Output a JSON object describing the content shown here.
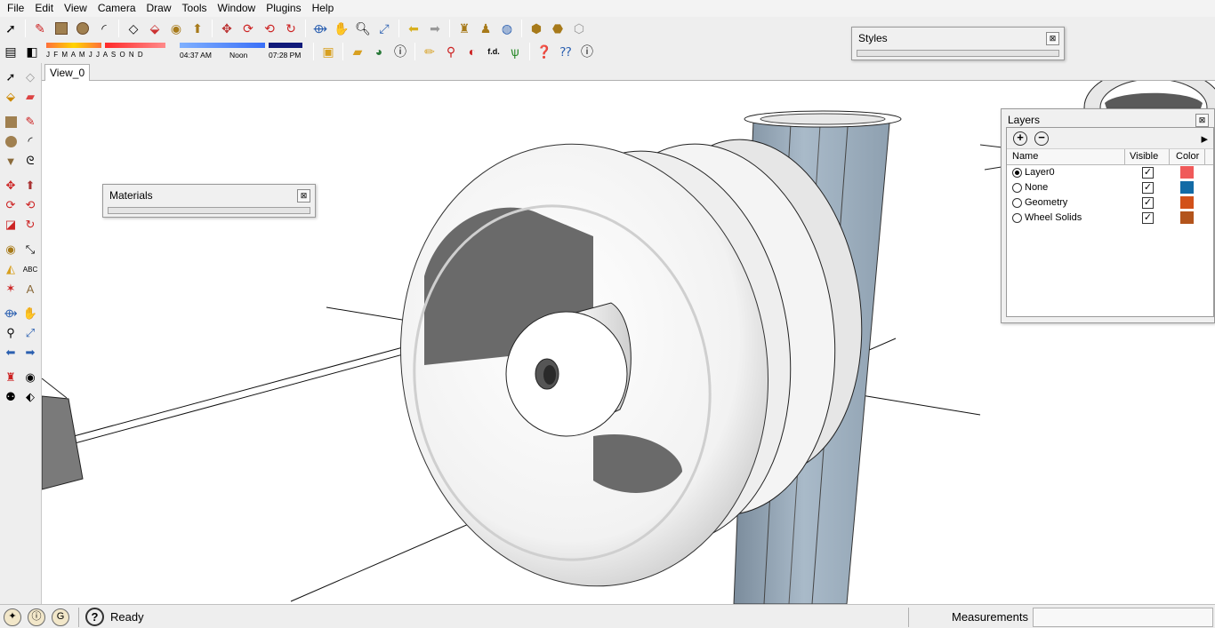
{
  "menu": [
    "File",
    "Edit",
    "View",
    "Camera",
    "Draw",
    "Tools",
    "Window",
    "Plugins",
    "Help"
  ],
  "shadow_months": "J F M A M J J A S O N D",
  "shadow_times": {
    "start": "04:37 AM",
    "mid": "Noon",
    "end": "07:28 PM"
  },
  "scene_tab": "View_0",
  "styles_tray": {
    "title": "Styles",
    "close": "⊠"
  },
  "materials_tray": {
    "title": "Materials",
    "close": "⊠"
  },
  "layers_tray": {
    "title": "Layers",
    "close": "⊠",
    "add": "+",
    "remove": "−",
    "details": "▸",
    "columns": {
      "name": "Name",
      "visible": "Visible",
      "color": "Color"
    },
    "rows": [
      {
        "name": "Layer0",
        "active": true,
        "visible": "✓",
        "color": "#f05a5a"
      },
      {
        "name": "None",
        "active": false,
        "visible": "✓",
        "color": "#136ba6"
      },
      {
        "name": "Geometry",
        "active": false,
        "visible": "✓",
        "color": "#d2511a"
      },
      {
        "name": "Wheel Solids",
        "active": false,
        "visible": "✓",
        "color": "#b3541c"
      }
    ]
  },
  "status": {
    "text": "Ready",
    "help": "?",
    "measurements_label": "Measurements"
  },
  "colors": {
    "pole": "#9fb1c2",
    "wheel_shade": "#6a6a6a",
    "box": "#7a7a7a"
  },
  "icons": {
    "top_row1": [
      "select-icon",
      "pencil-icon",
      "rectangle-icon",
      "circle-icon",
      "arc-icon",
      "eraser-icon",
      "paint-bucket-icon",
      "tape-icon",
      "push-pull-icon",
      "move-icon",
      "rotate-icon",
      "offset-icon",
      "orbit-icon",
      "pan-icon",
      "zoom-icon",
      "zoom-extents-icon",
      "previous-view-icon",
      "next-view-icon",
      "walk-icon",
      "position-camera-icon",
      "look-around-icon",
      "component-icon",
      "group-icon",
      "section-icon"
    ],
    "top_row2": [
      "get-models-icon",
      "share-icon",
      "sandbox-icon",
      "folder-icon",
      "globe-icon",
      "info-icon",
      "pencil2-icon",
      "dropper-icon",
      "outline-icon",
      "fd-icon",
      "grass-icon",
      "help-icon",
      "query-icon",
      "about-icon"
    ]
  }
}
